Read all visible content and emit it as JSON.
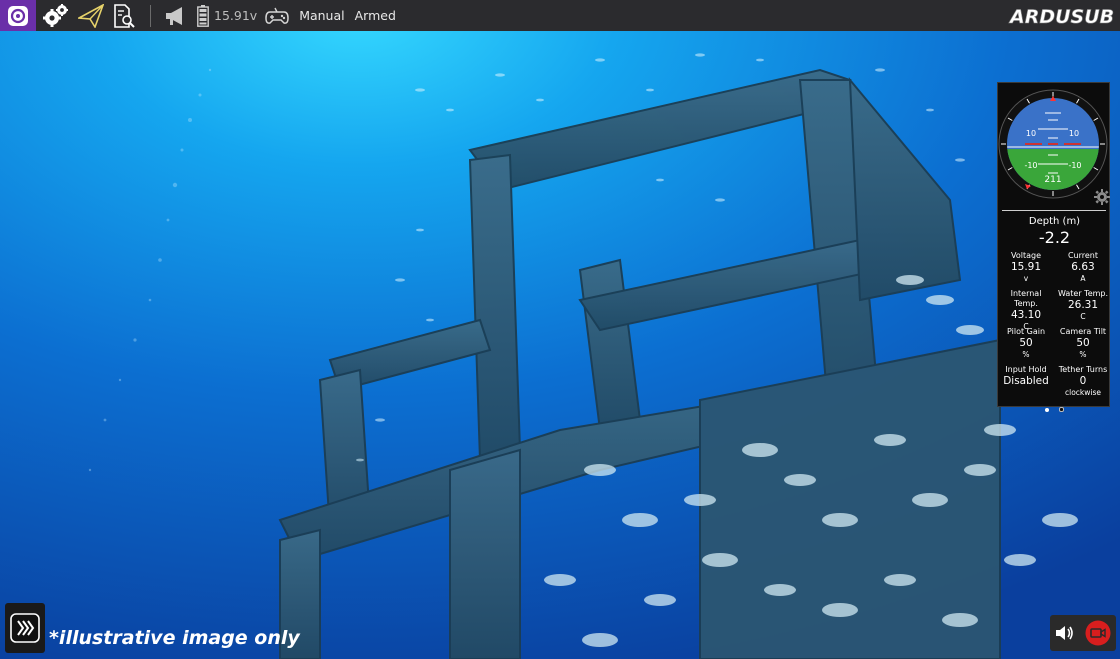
{
  "toolbar": {
    "voltage": "15.91v",
    "flight_mode": "Manual",
    "arm_state": "Armed",
    "brand": "ARDUSUB"
  },
  "attitude": {
    "pitch_labels_upper": [
      "10",
      "10"
    ],
    "pitch_labels_lower": [
      "-10",
      "-10"
    ],
    "heading": "211",
    "pitch_deg": 5,
    "roll_deg": 0
  },
  "depth": {
    "label": "Depth (m)",
    "value": "-2.2"
  },
  "telemetry": [
    {
      "label": "Voltage",
      "value": "15.91",
      "unit": "v"
    },
    {
      "label": "Current",
      "value": "6.63",
      "unit": "A"
    },
    {
      "label": "Internal Temp.",
      "value": "43.10",
      "unit": "C"
    },
    {
      "label": "Water Temp.",
      "value": "26.31",
      "unit": "C"
    },
    {
      "label": "Pilot Gain",
      "value": "50",
      "unit": "%"
    },
    {
      "label": "Camera Tilt",
      "value": "50",
      "unit": "%"
    },
    {
      "label": "Input Hold",
      "value": "Disabled",
      "unit": ""
    },
    {
      "label": "Tether Turns",
      "value": "0",
      "unit": "clockwise"
    }
  ],
  "watermark": "*illustrative image only",
  "colors": {
    "toolbar_bg": "#2b2b2e",
    "logo_purple": "#6a2fa8",
    "sky": "#3a72c8",
    "ground": "#3aa63a",
    "record_red": "#d81e1e",
    "pitch_red": "#cc3333"
  },
  "icons": {
    "app": "qgc-logo-icon",
    "settings": "gears-icon",
    "plan": "paper-plane-icon",
    "analyze": "document-search-icon",
    "messages": "megaphone-icon",
    "battery": "battery-icon",
    "joystick": "gamepad-icon"
  }
}
